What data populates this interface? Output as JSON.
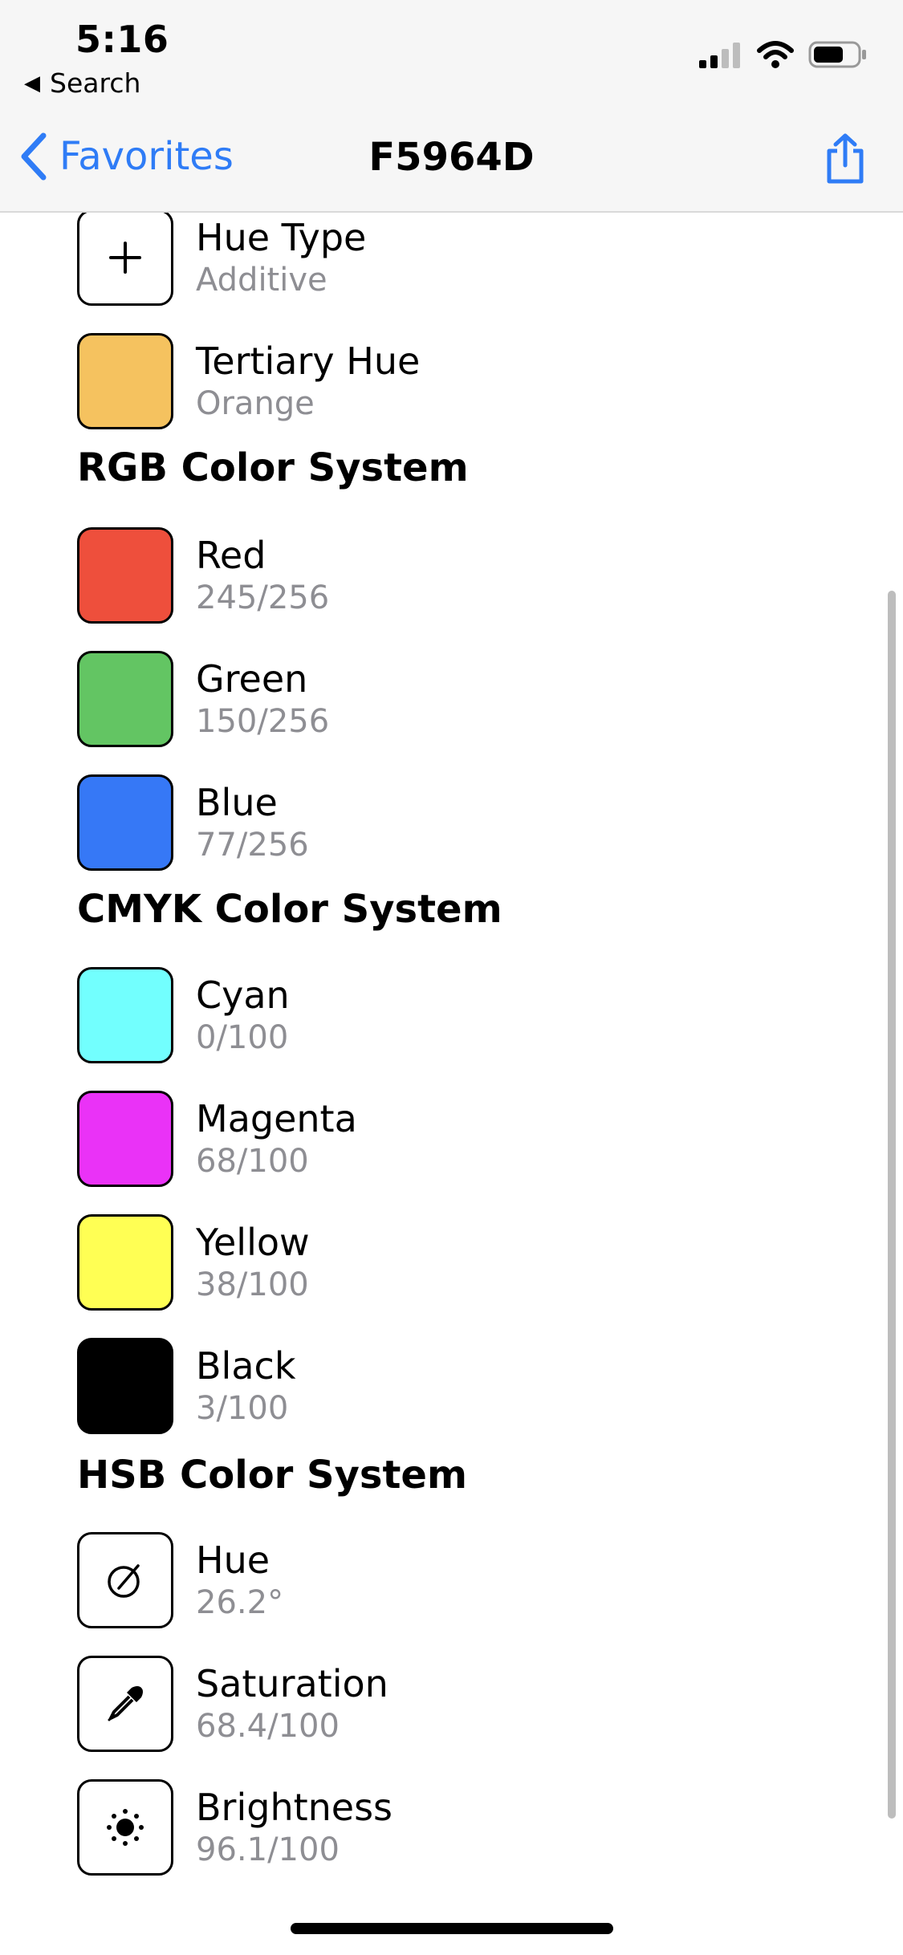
{
  "status_bar": {
    "time": "5:16",
    "back_app_label": "Search"
  },
  "nav": {
    "back_label": "Favorites",
    "title": "F5964D",
    "accent": "#2F7CF6"
  },
  "rows_top": [
    {
      "title": "Hue Type",
      "subtitle": "Additive",
      "icon": "plus-icon"
    },
    {
      "title": "Tertiary Hue",
      "subtitle": "Orange",
      "color": "#F5C25F"
    }
  ],
  "sections": {
    "rgb": {
      "heading": "RGB Color System",
      "items": [
        {
          "title": "Red",
          "subtitle": "245/256",
          "color": "#EE4F3C"
        },
        {
          "title": "Green",
          "subtitle": "150/256",
          "color": "#63C563"
        },
        {
          "title": "Blue",
          "subtitle": "77/256",
          "color": "#3678F6"
        }
      ]
    },
    "cmyk": {
      "heading": "CMYK Color System",
      "items": [
        {
          "title": "Cyan",
          "subtitle": "0/100",
          "color": "#72FFFE"
        },
        {
          "title": "Magenta",
          "subtitle": "68/100",
          "color": "#EA32F7"
        },
        {
          "title": "Yellow",
          "subtitle": "38/100",
          "color": "#FFFF54"
        },
        {
          "title": "Black",
          "subtitle": "3/100",
          "color": "#000000"
        }
      ]
    },
    "hsb": {
      "heading": "HSB Color System",
      "items": [
        {
          "title": "Hue",
          "subtitle": "26.2°",
          "icon": "dial-icon"
        },
        {
          "title": "Saturation",
          "subtitle": "68.4/100",
          "icon": "eyedropper-icon"
        },
        {
          "title": "Brightness",
          "subtitle": "96.1/100",
          "icon": "sun-icon"
        }
      ]
    }
  }
}
